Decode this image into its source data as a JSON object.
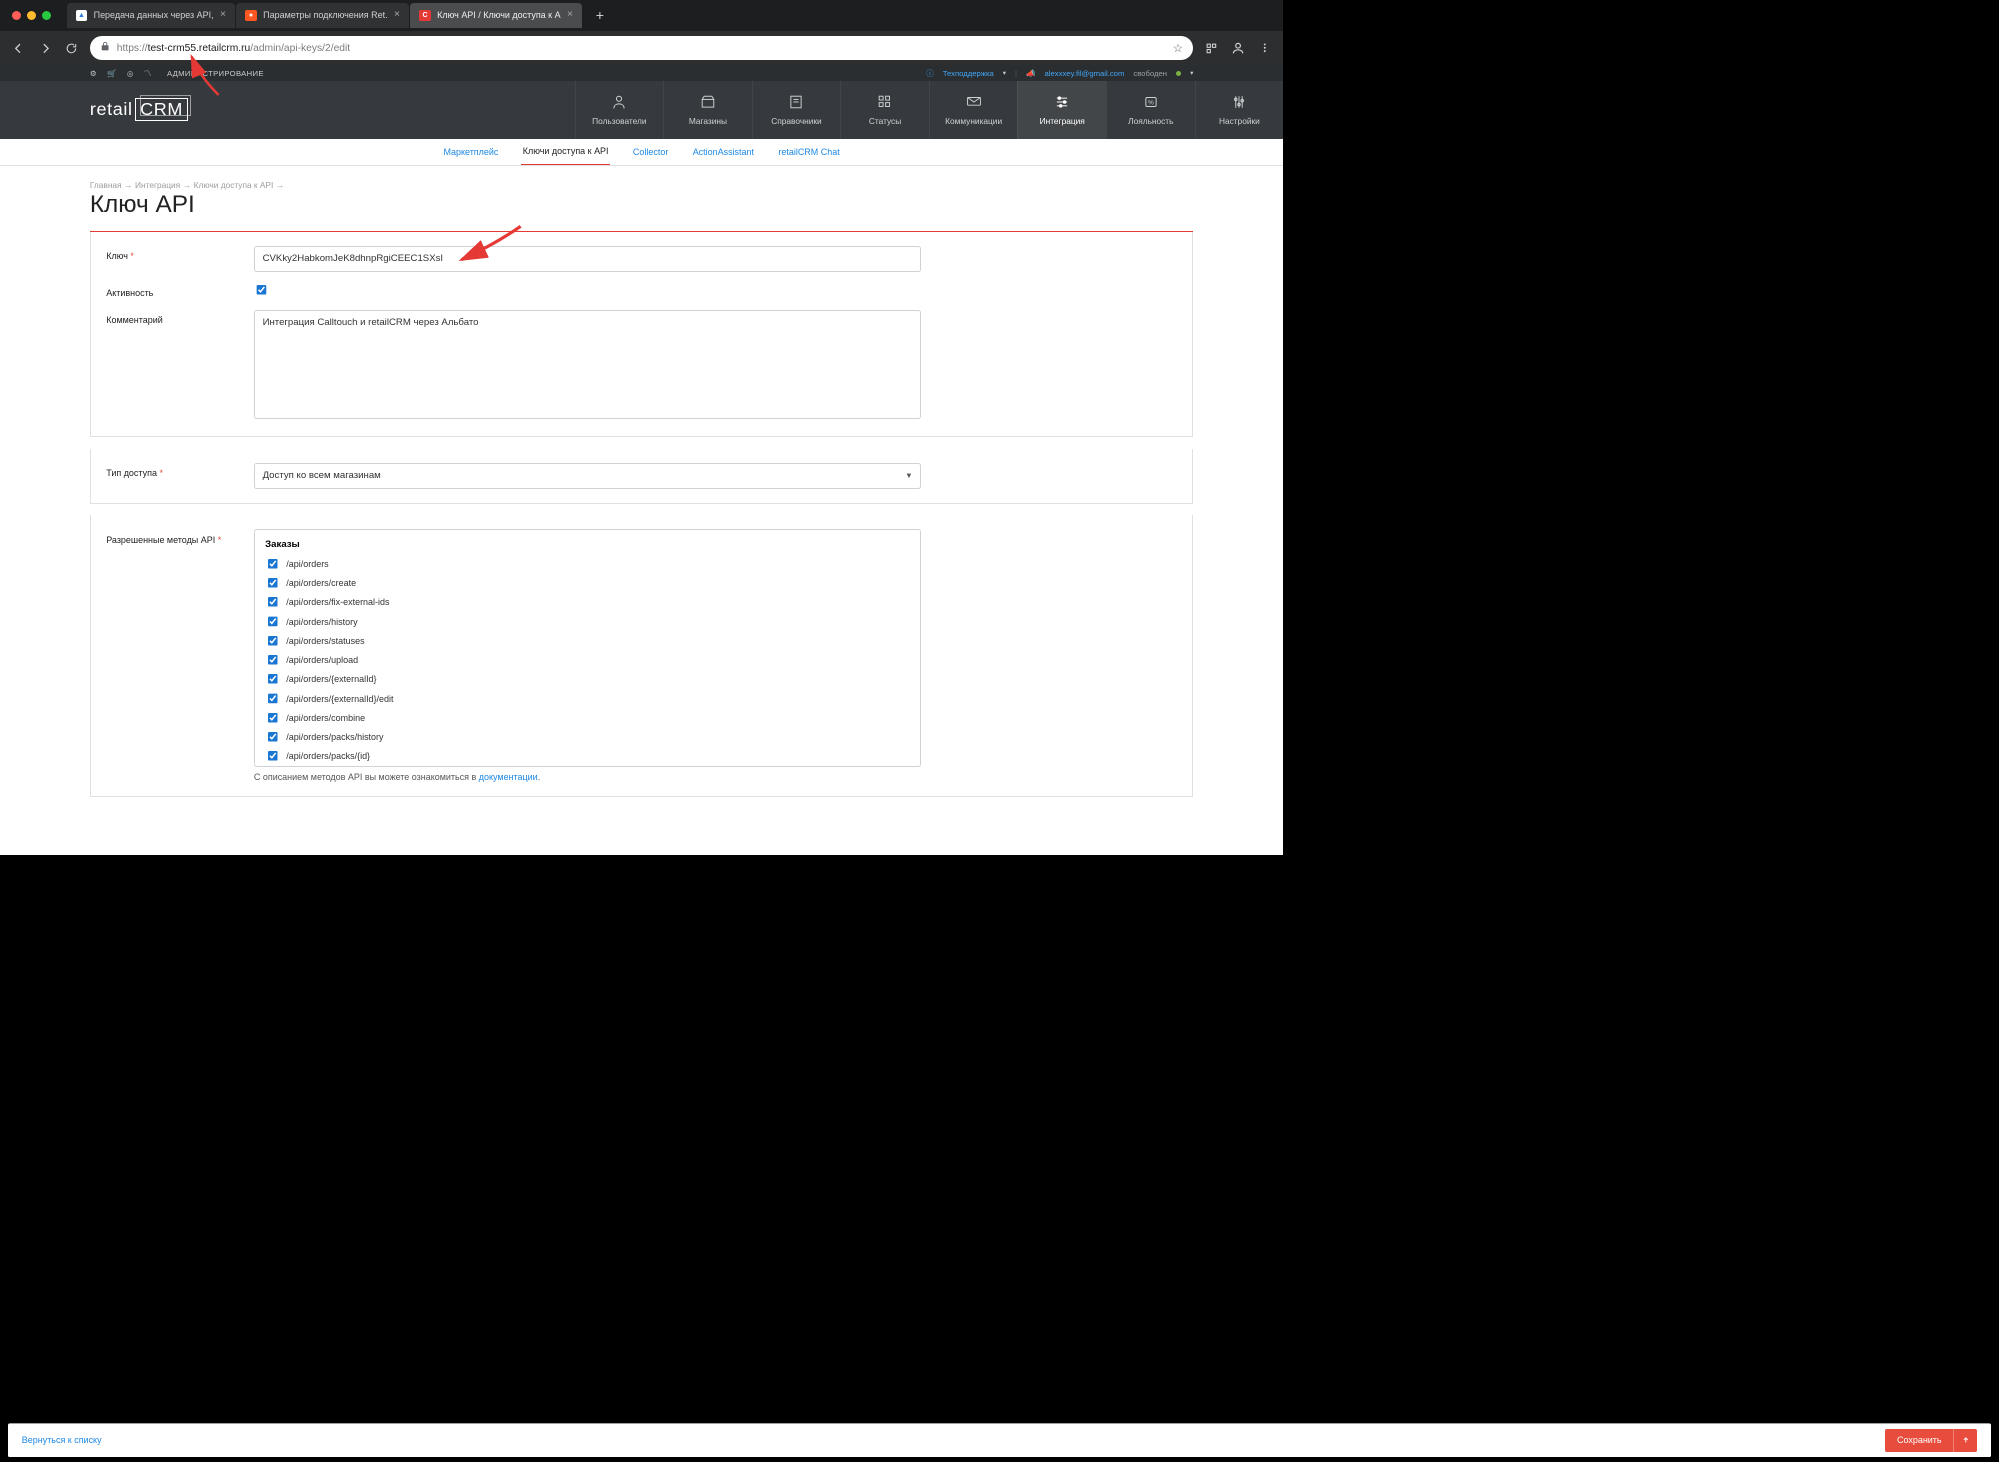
{
  "browser": {
    "tabs": [
      {
        "title": "Передача данных через API,",
        "active": false,
        "favicon_bg": "#ffffff",
        "favicon_fg": "#2a7de1",
        "favicon_text": "▲"
      },
      {
        "title": "Параметры подключения Ret.",
        "active": false,
        "favicon_bg": "#ff5722",
        "favicon_fg": "#ffffff",
        "favicon_text": "●"
      },
      {
        "title": "Ключ API / Ключи доступа к A",
        "active": true,
        "favicon_bg": "#e53935",
        "favicon_fg": "#ffffff",
        "favicon_text": "C"
      }
    ],
    "url_prefix": "https://",
    "url_host": "test-crm55.retailcrm.ru",
    "url_path": "/admin/api-keys/2/edit"
  },
  "topstrip": {
    "admin_label": "АДМИНИСТРИРОВАНИЕ",
    "support_label": "Техподдержка",
    "user_email": "alexxxey.fil@gmail.com",
    "user_status": "свободен"
  },
  "mainnav": [
    {
      "key": "users",
      "label": "Пользователи"
    },
    {
      "key": "shops",
      "label": "Магазины"
    },
    {
      "key": "refs",
      "label": "Справочники"
    },
    {
      "key": "statuses",
      "label": "Статусы"
    },
    {
      "key": "comms",
      "label": "Коммуникации"
    },
    {
      "key": "integration",
      "label": "Интеграция",
      "active": true
    },
    {
      "key": "loyalty",
      "label": "Лояльность"
    },
    {
      "key": "settings",
      "label": "Настройки"
    }
  ],
  "subnav": [
    {
      "label": "Маркетплейс"
    },
    {
      "label": "Ключи доступа к API",
      "active": true
    },
    {
      "label": "Collector"
    },
    {
      "label": "ActionAssistant"
    },
    {
      "label": "retailCRM Chat"
    }
  ],
  "breadcrumb": [
    "Главная",
    "Интеграция",
    "Ключи доступа к API",
    ""
  ],
  "page_title": "Ключ API",
  "form": {
    "key_label": "Ключ",
    "key_value": "CVKky2HabkomJeK8dhnpRgiCEEC1SXsI",
    "active_label": "Активность",
    "active_checked": true,
    "comment_label": "Комментарий",
    "comment_value": "Интеграция Calltouch и retailCRM через Альбато",
    "access_type_label": "Тип доступа",
    "access_type_value": "Доступ ко всем магазинам",
    "methods_label": "Разрешенные методы API",
    "methods_group": "Заказы",
    "methods": [
      "/api/orders",
      "/api/orders/create",
      "/api/orders/fix-external-ids",
      "/api/orders/history",
      "/api/orders/statuses",
      "/api/orders/upload",
      "/api/orders/{externalId}",
      "/api/orders/{externalId}/edit",
      "/api/orders/combine",
      "/api/orders/packs/history",
      "/api/orders/packs/{id}"
    ],
    "doc_text": "С описанием методов API вы можете ознакомиться в ",
    "doc_link": "документации"
  },
  "actionbar": {
    "back": "Вернуться к списку",
    "save": "Сохранить"
  },
  "logo_text1": "retail",
  "logo_text2": "CRM"
}
